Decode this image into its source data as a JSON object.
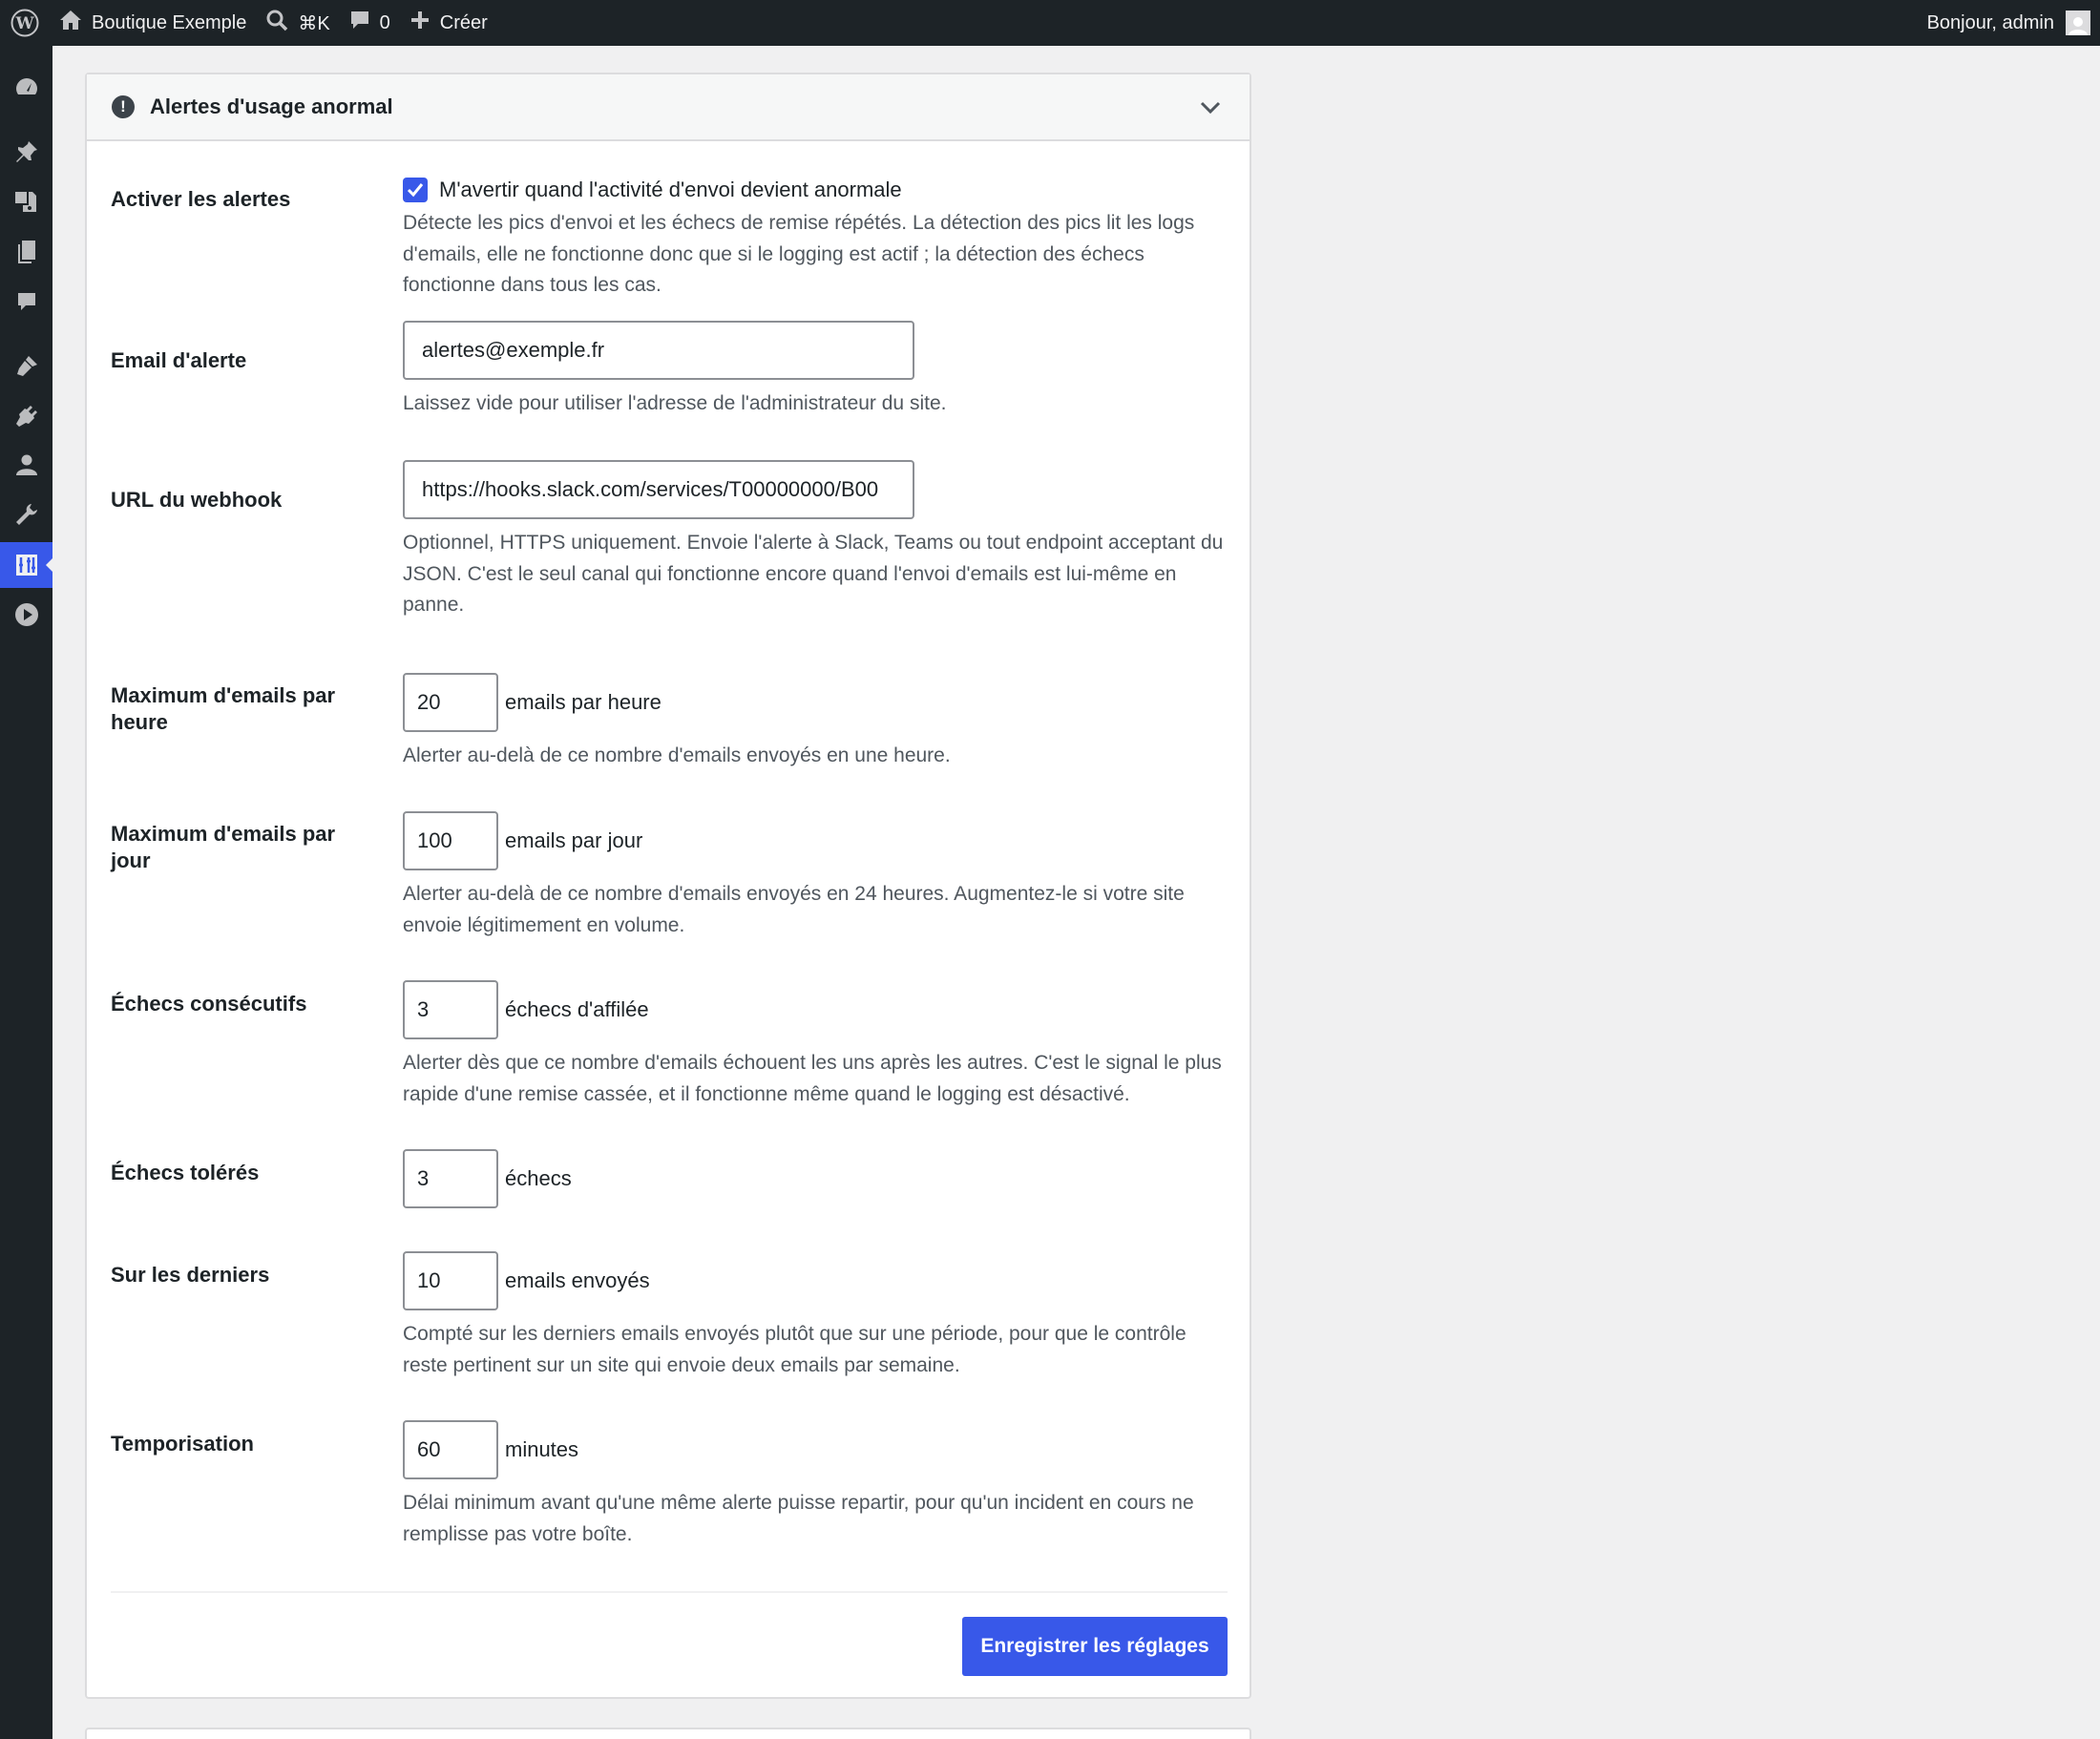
{
  "adminbar": {
    "site_name": "Boutique Exemple",
    "shortcut": "⌘K",
    "comments_count": "0",
    "new_label": "Créer",
    "greeting": "Bonjour, admin"
  },
  "sidebar": {
    "items": [
      {
        "icon": "dashboard-icon"
      },
      {
        "icon": "pin-icon"
      },
      {
        "icon": "media-icon"
      },
      {
        "icon": "pages-icon"
      },
      {
        "icon": "comments-icon"
      },
      {
        "icon": "appearance-icon"
      },
      {
        "icon": "plugins-icon"
      },
      {
        "icon": "users-icon"
      },
      {
        "icon": "tools-icon"
      },
      {
        "icon": "settings-icon",
        "current": true
      },
      {
        "icon": "play-icon"
      }
    ],
    "accent_color": "#3858e9"
  },
  "panel": {
    "title": "Alertes d'usage anormal",
    "enable": {
      "label": "Activer les alertes",
      "checkbox_label": "M'avertir quand l'activité d'envoi devient anormale",
      "checked": true,
      "desc": "Détecte les pics d'envoi et les échecs de remise répétés. La détection des pics lit les logs d'emails, elle ne fonctionne donc que si le logging est actif ; la détection des échecs fonctionne dans tous les cas."
    },
    "email": {
      "label": "Email d'alerte",
      "value": "alertes@exemple.fr",
      "desc": "Laissez vide pour utiliser l'adresse de l'administrateur du site."
    },
    "webhook": {
      "label": "URL du webhook",
      "value": "https://hooks.slack.com/services/T00000000/B00",
      "desc": "Optionnel, HTTPS uniquement. Envoie l'alerte à Slack, Teams ou tout endpoint acceptant du JSON. C'est le seul canal qui fonctionne encore quand l'envoi d'emails est lui-même en panne."
    },
    "max_hour": {
      "label": "Maximum d'emails par heure",
      "value": "20",
      "unit": "emails par heure",
      "desc": "Alerter au-delà de ce nombre d'emails envoyés en une heure."
    },
    "max_day": {
      "label": "Maximum d'emails par jour",
      "value": "100",
      "unit": "emails par jour",
      "desc": "Alerter au-delà de ce nombre d'emails envoyés en 24 heures. Augmentez-le si votre site envoie légitimement en volume."
    },
    "consecutive": {
      "label": "Échecs consécutifs",
      "value": "3",
      "unit": "échecs d'affilée",
      "desc": "Alerter dès que ce nombre d'emails échouent les uns après les autres. C'est le signal le plus rapide d'une remise cassée, et il fonctionne même quand le logging est désactivé."
    },
    "tolerated": {
      "label": "Échecs tolérés",
      "value": "3",
      "unit": "échecs"
    },
    "last": {
      "label": "Sur les derniers",
      "value": "10",
      "unit": "emails envoyés",
      "desc": "Compté sur les derniers emails envoyés plutôt que sur une période, pour que le contrôle reste pertinent sur un site qui envoie deux emails par semaine."
    },
    "cooldown": {
      "label": "Temporisation",
      "value": "60",
      "unit": "minutes",
      "desc": "Délai minimum avant qu'une même alerte puisse repartir, pour qu'un incident en cours ne remplisse pas votre boîte."
    },
    "save_label": "Enregistrer les réglages"
  }
}
